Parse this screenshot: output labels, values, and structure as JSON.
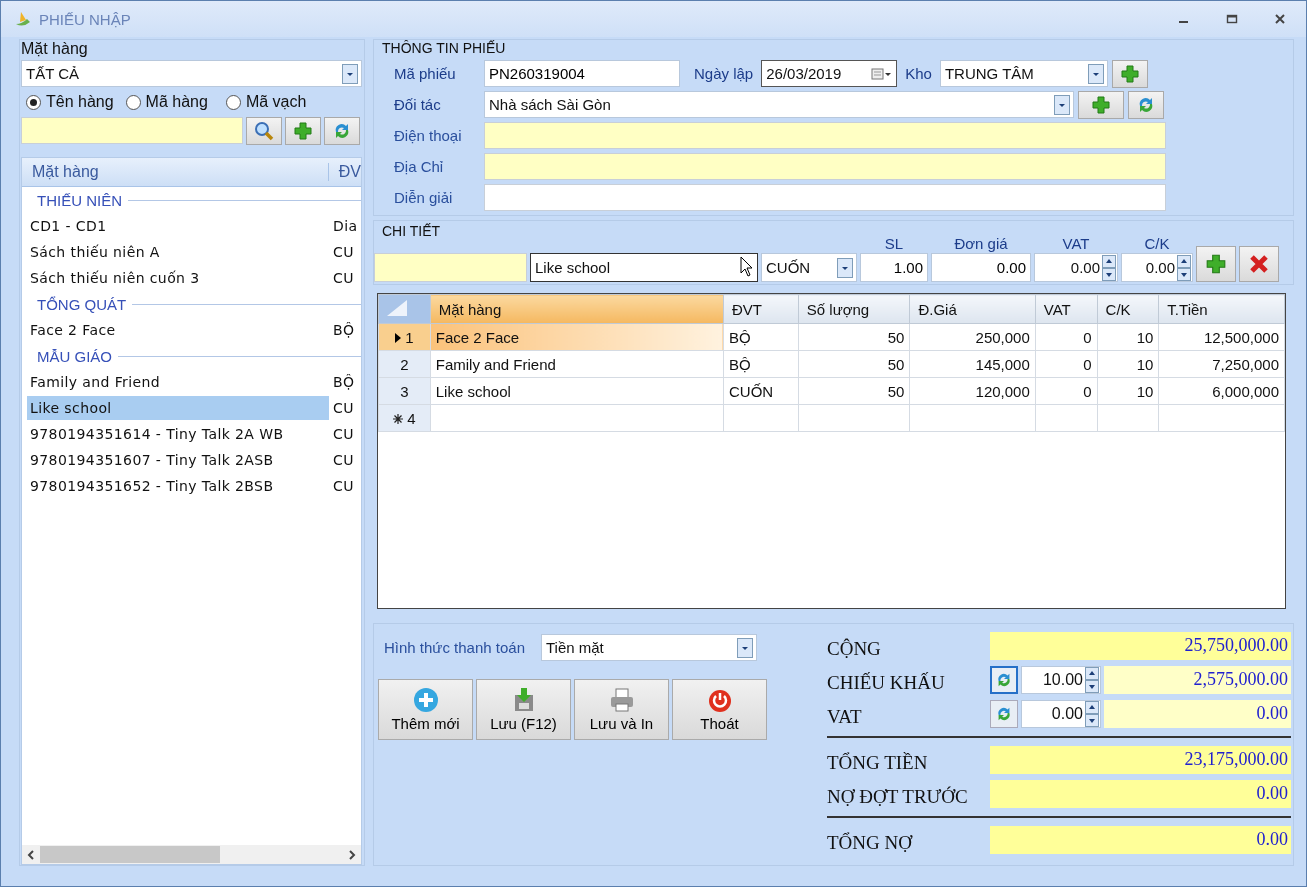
{
  "window": {
    "title": "PHIẾU NHẬP"
  },
  "left": {
    "title": "Mặt hàng",
    "category": "TẤT CẢ",
    "search_modes": [
      {
        "label": "Tên hàng",
        "selected": true
      },
      {
        "label": "Mã hàng",
        "selected": false
      },
      {
        "label": "Mã vạch",
        "selected": false
      }
    ],
    "list": {
      "columns": [
        "Mặt hàng",
        "ĐV"
      ],
      "groups": [
        {
          "name": "THIẾU NIÊN",
          "items": [
            {
              "name": "CD1 - CD1",
              "unit": "Dia",
              "selected": false
            },
            {
              "name": "Sách thiếu niên A",
              "unit": "CU",
              "selected": false
            },
            {
              "name": "Sách thiếu niên cuốn 3",
              "unit": "CU",
              "selected": false
            }
          ]
        },
        {
          "name": "TỔNG QUÁT",
          "items": [
            {
              "name": "Face 2 Face",
              "unit": "BỘ",
              "selected": false
            }
          ]
        },
        {
          "name": "MẪU GIÁO",
          "items": [
            {
              "name": "Family and Friend",
              "unit": "BỘ",
              "selected": false
            },
            {
              "name": "Like school",
              "unit": "CU",
              "selected": true
            },
            {
              "name": "9780194351614 - Tiny Talk 2A WB",
              "unit": "CU",
              "selected": false
            },
            {
              "name": "9780194351607 - Tiny Talk 2ASB",
              "unit": "CU",
              "selected": false
            },
            {
              "name": "9780194351652 - Tiny Talk 2BSB",
              "unit": "CU",
              "selected": false
            }
          ]
        }
      ]
    }
  },
  "info": {
    "title": "THÔNG TIN PHIẾU",
    "ma_phieu": {
      "label": "Mã phiếu",
      "value": "PN260319004"
    },
    "ngay_lap": {
      "label": "Ngày lập",
      "value": "26/03/2019"
    },
    "kho": {
      "label": "Kho",
      "value": "TRUNG TÂM"
    },
    "doi_tac": {
      "label": "Đối tác",
      "value": "Nhà sách Sài Gòn"
    },
    "dien_thoai": {
      "label": "Điện thoại"
    },
    "dia_chi": {
      "label": "Địa Chỉ"
    },
    "dien_giai": {
      "label": "Diễn giải"
    }
  },
  "detail": {
    "title": "CHI TIẾT",
    "item": "Like school",
    "unit": "CUỐN",
    "inputs": [
      {
        "label": "SL",
        "value": "1.00",
        "kind": "plain"
      },
      {
        "label": "Đơn giá",
        "value": "0.00",
        "kind": "plain"
      },
      {
        "label": "VAT",
        "value": "0.00",
        "kind": "spin"
      },
      {
        "label": "C/K",
        "value": "0.00",
        "kind": "spin"
      }
    ]
  },
  "grid": {
    "columns": [
      "Mặt hàng",
      "ĐVT",
      "Số lượng",
      "Đ.Giá",
      "VAT",
      "C/K",
      "T.Tiền"
    ],
    "rows": [
      {
        "no": "1",
        "selected": true,
        "cells": [
          "Face 2 Face",
          "BỘ",
          "50",
          "250,000",
          "0",
          "10",
          "12,500,000"
        ]
      },
      {
        "no": "2",
        "selected": false,
        "cells": [
          "Family and Friend",
          "BỘ",
          "50",
          "145,000",
          "0",
          "10",
          "7,250,000"
        ]
      },
      {
        "no": "3",
        "selected": false,
        "cells": [
          "Like school",
          "CUỐN",
          "50",
          "120,000",
          "0",
          "10",
          "6,000,000"
        ]
      }
    ],
    "new_row": "4"
  },
  "payment": {
    "label": "Hình thức thanh toán",
    "value": "Tiền mặt"
  },
  "buttons": [
    {
      "label": "Thêm mới",
      "kind": "add"
    },
    {
      "label": "Lưu (F12)",
      "kind": "save"
    },
    {
      "label": "Lưu và In",
      "kind": "print"
    },
    {
      "label": "Thoát",
      "kind": "exit"
    }
  ],
  "totals": [
    {
      "kind": "plain",
      "label": "CỘNG",
      "value": "25,750,000.00"
    },
    {
      "kind": "rate",
      "label": "CHIẾU KHẤU",
      "rate": "10.00",
      "value": "2,575,000.00"
    },
    {
      "kind": "rate",
      "label": "VAT",
      "rate": "0.00",
      "value": "0.00"
    },
    {
      "kind": "divider"
    },
    {
      "kind": "plain",
      "label": "TỔNG TIỀN",
      "value": "23,175,000.00"
    },
    {
      "kind": "plain",
      "label": "NỢ ĐỢT TRƯỚC",
      "value": "0.00"
    },
    {
      "kind": "divider"
    },
    {
      "kind": "plain",
      "label": "TỔNG NỢ",
      "value": "0.00"
    }
  ]
}
